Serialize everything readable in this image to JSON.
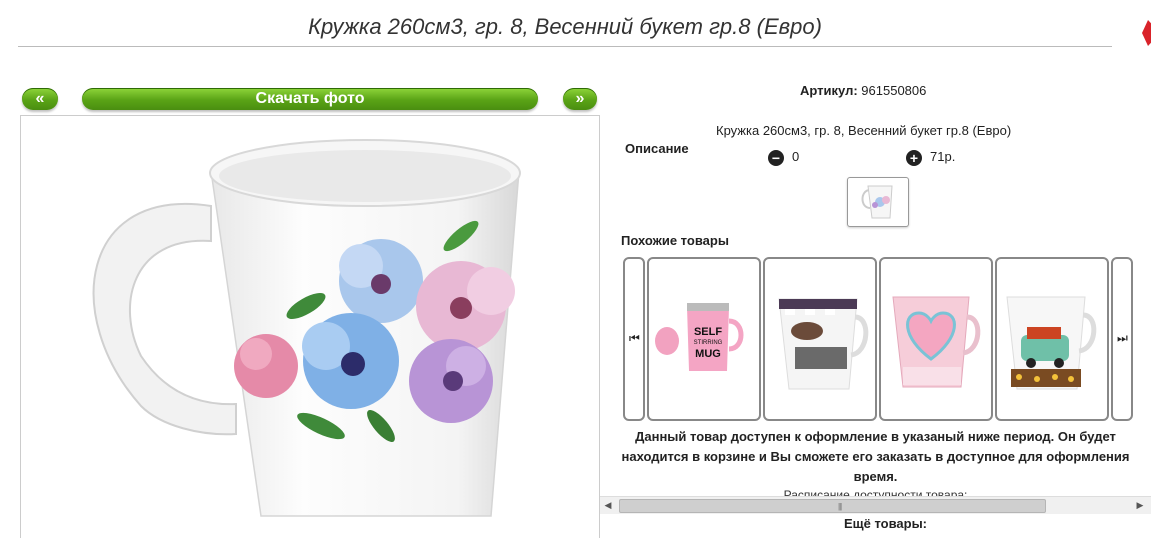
{
  "page": {
    "title": "Кружка 260см3, гр. 8, Весенний букет гр.8 (Евро)"
  },
  "toolbar": {
    "prev_label": "«",
    "download_label": "Скачать фото",
    "next_label": "»"
  },
  "product": {
    "article_label": "Артикул:",
    "article_value": "961550806",
    "description_label": "Описание",
    "description_text": "Кружка 260см3, гр. 8, Весенний букет гр.8 (Евро)",
    "minus_symbol": "−",
    "plus_symbol": "+",
    "quantity": "0",
    "price": "71р."
  },
  "similar": {
    "label": "Похожие товары",
    "prev_icon": "skip-previous-icon",
    "next_icon": "skip-next-icon",
    "items": [
      {
        "name": "self-stirring-mug",
        "lines": [
          "SELF",
          "STIRRING",
          "MUG"
        ]
      },
      {
        "name": "coffee-mug"
      },
      {
        "name": "heart-mug"
      },
      {
        "name": "car-mug"
      }
    ]
  },
  "availability": {
    "text": "Данный товар доступен к оформление в указаный ниже период. Он будет находится в корзине и Вы сможете его заказать в доступное для оформления время.",
    "schedule": "Расписание доступности товара:"
  },
  "more": {
    "label": "Ещё товары:"
  },
  "colors": {
    "accent_green": "#5aa316",
    "corner_red": "#d9232a"
  }
}
